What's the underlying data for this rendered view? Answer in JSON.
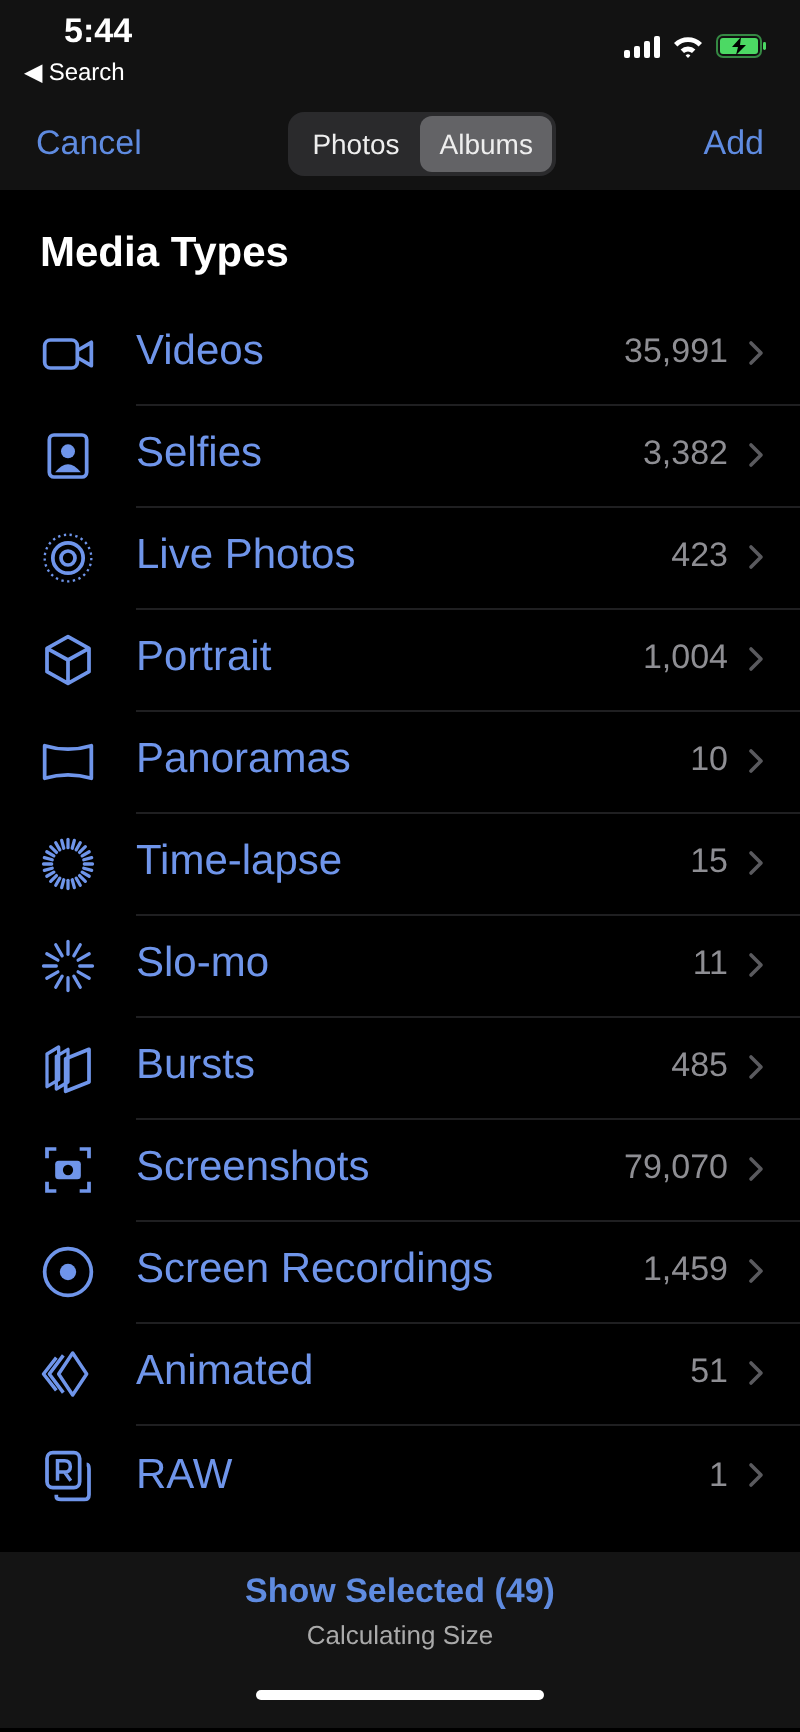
{
  "status_bar": {
    "time": "5:44",
    "back_link": "◀ Search"
  },
  "nav": {
    "cancel": "Cancel",
    "add": "Add",
    "tabs": [
      {
        "label": "Photos",
        "selected": false
      },
      {
        "label": "Albums",
        "selected": true
      }
    ]
  },
  "section_title": "Media Types",
  "items": [
    {
      "kind": "video",
      "label": "Videos",
      "count": "35,991"
    },
    {
      "kind": "selfie",
      "label": "Selfies",
      "count": "3,382"
    },
    {
      "kind": "live",
      "label": "Live Photos",
      "count": "423"
    },
    {
      "kind": "portrait",
      "label": "Portrait",
      "count": "1,004"
    },
    {
      "kind": "panorama",
      "label": "Panoramas",
      "count": "10"
    },
    {
      "kind": "timelapse",
      "label": "Time-lapse",
      "count": "15"
    },
    {
      "kind": "slomo",
      "label": "Slo-mo",
      "count": "11"
    },
    {
      "kind": "bursts",
      "label": "Bursts",
      "count": "485"
    },
    {
      "kind": "screenshot",
      "label": "Screenshots",
      "count": "79,070"
    },
    {
      "kind": "recording",
      "label": "Screen Recordings",
      "count": "1,459"
    },
    {
      "kind": "animated",
      "label": "Animated",
      "count": "51"
    },
    {
      "kind": "raw",
      "label": "RAW",
      "count": "1"
    }
  ],
  "footer": {
    "action": "Show Selected (49)",
    "status": "Calculating Size"
  }
}
